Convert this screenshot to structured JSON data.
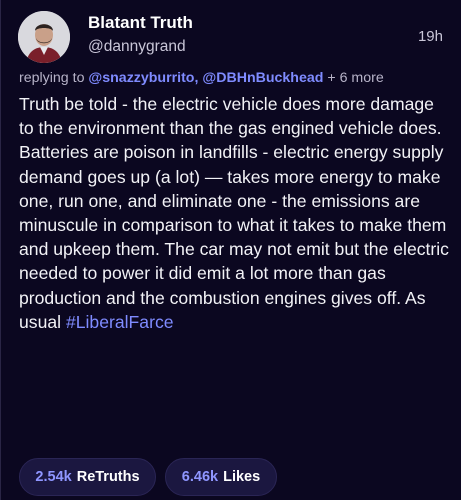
{
  "post": {
    "author": {
      "display_name": "Blatant Truth",
      "handle": "@dannygrand",
      "avatar_icon": "user-avatar"
    },
    "time": "19h",
    "reply": {
      "prefix": "replying to ",
      "mentions": [
        "@snazzyburrito",
        "@DBHnBuckhead"
      ],
      "separator": ", ",
      "more": " + 6 more"
    },
    "text": "Truth be told - the electric vehicle does more damage to the environment than the gas engined vehicle does. Batteries are poison in landfills - electric energy supply demand goes up (a lot) — takes more energy to make one, run one, and eliminate one - the emissions are minuscule in comparison to what it takes to make them and upkeep them. The car may not emit but the electric needed to power it did emit a lot more than gas production and the combustion engines gives off. As usual ",
    "hashtag": "#LiberalFarce",
    "stats": {
      "retruths_count": "2.54k",
      "retruths_label": "ReTruths",
      "likes_count": "6.46k",
      "likes_label": "Likes"
    }
  },
  "colors": {
    "background": "#0b0720",
    "mention": "#7f8bff",
    "button_bg": "#1b1740"
  }
}
